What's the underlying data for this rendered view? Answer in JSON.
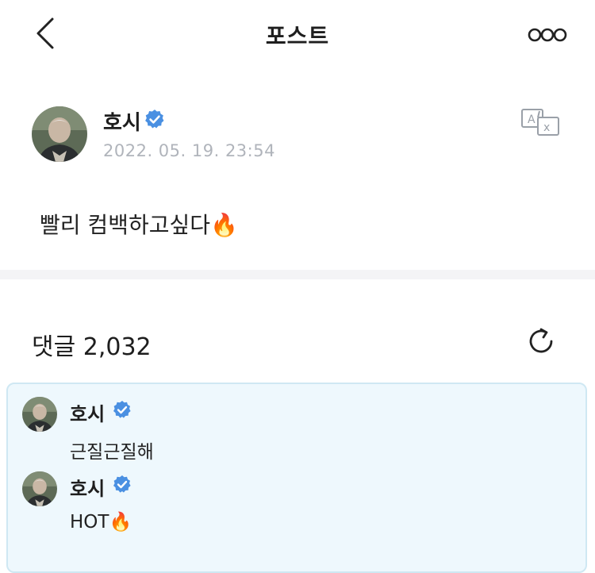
{
  "header": {
    "title": "포스트",
    "back_icon": "chevron-left-icon",
    "more_icon": "more-dots-icon"
  },
  "post": {
    "author": "호시",
    "timestamp": "2022. 05. 19. 23:54",
    "text": "빨리 컴백하고싶다",
    "emoji": "🔥",
    "translate_icon": "translate-icon"
  },
  "comments": {
    "count_label": "댓글 2,032",
    "refresh_icon": "refresh-icon",
    "items": [
      {
        "author": "호시",
        "text": "근질근질해",
        "emoji": ""
      },
      {
        "author": "호시",
        "text": "HOT",
        "emoji": "🔥"
      }
    ]
  },
  "colors": {
    "verified": "#4a90e2",
    "timestamp": "#b0b4bb",
    "highlight_bg": "#eef8fd",
    "highlight_border": "#cfe8f3"
  }
}
